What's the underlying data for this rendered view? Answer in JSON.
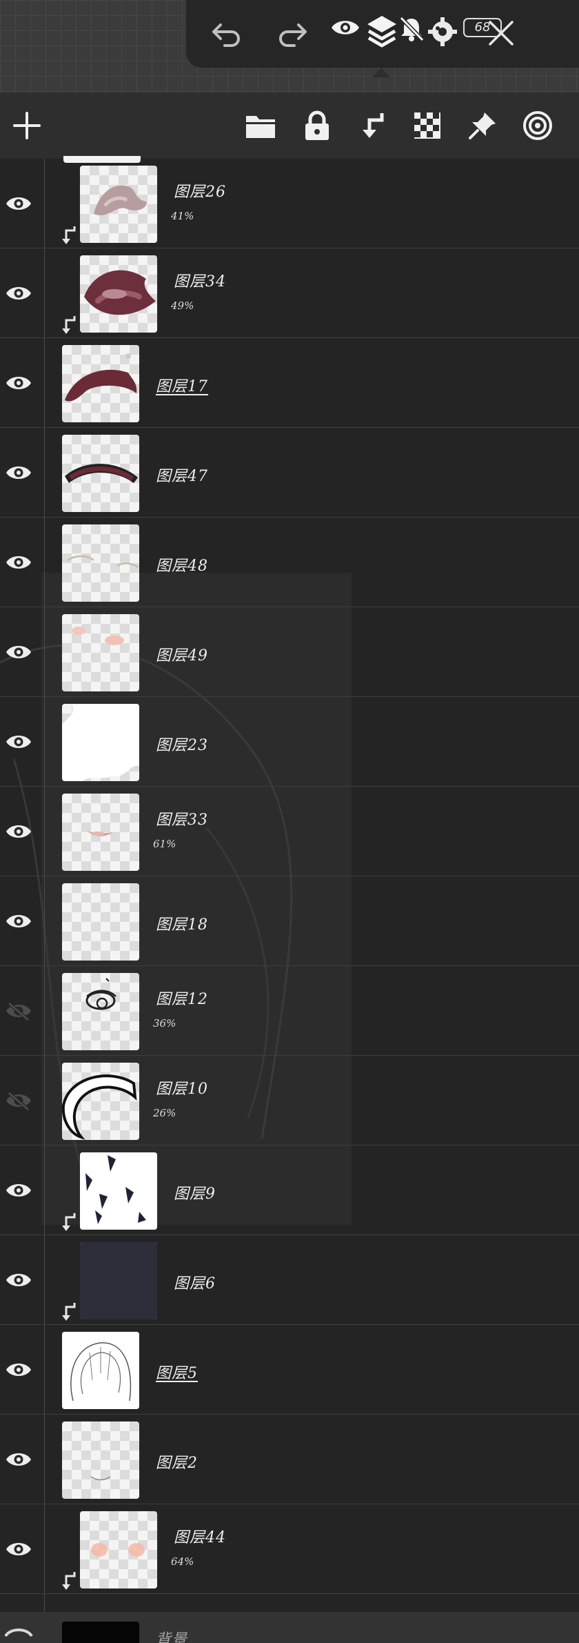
{
  "toolbar": {
    "undo_icon": "undo-icon",
    "redo_icon": "redo-icon",
    "view_icon": "eye-icon",
    "layers_icon": "layers-icon",
    "notify_icon": "bell-off-icon",
    "settings_icon": "gear-icon",
    "badge": "68",
    "close_icon": "close-icon"
  },
  "panel_header": {
    "add_icon": "plus-icon",
    "folder_icon": "folder-icon",
    "lock_icon": "lock-icon",
    "clip_icon": "clip-arrow-icon",
    "alpha_icon": "checker-icon",
    "pin_icon": "pin-icon",
    "target_icon": "target-icon"
  },
  "layers": [
    {
      "name": "图层26",
      "opacity": "41%",
      "visible": true,
      "clipped": true,
      "thumb": "pink-smudge"
    },
    {
      "name": "图层34",
      "opacity": "49%",
      "visible": true,
      "clipped": true,
      "thumb": "lips-dark"
    },
    {
      "name": "图层17",
      "opacity": "",
      "visible": true,
      "clipped": false,
      "thumb": "brow-stroke",
      "underline": true
    },
    {
      "name": "图层47",
      "opacity": "",
      "visible": true,
      "clipped": false,
      "thumb": "brow-arc"
    },
    {
      "name": "图层48",
      "opacity": "",
      "visible": true,
      "clipped": false,
      "thumb": "faint-lines"
    },
    {
      "name": "图层49",
      "opacity": "",
      "visible": true,
      "clipped": false,
      "thumb": "blush-dots"
    },
    {
      "name": "图层23",
      "opacity": "",
      "visible": true,
      "clipped": false,
      "thumb": "white-shape"
    },
    {
      "name": "图层33",
      "opacity": "61%",
      "visible": true,
      "clipped": false,
      "thumb": "small-mouth"
    },
    {
      "name": "图层18",
      "opacity": "",
      "visible": true,
      "clipped": false,
      "thumb": "empty"
    },
    {
      "name": "图层12",
      "opacity": "36%",
      "visible": false,
      "clipped": false,
      "thumb": "eye-sketch"
    },
    {
      "name": "图层10",
      "opacity": "26%",
      "visible": false,
      "clipped": false,
      "thumb": "crescent"
    },
    {
      "name": "图层9",
      "opacity": "",
      "visible": true,
      "clipped": true,
      "thumb": "dark-shards"
    },
    {
      "name": "图层6",
      "opacity": "",
      "visible": true,
      "clipped": true,
      "thumb": "dark-fill"
    },
    {
      "name": "图层5",
      "opacity": "",
      "visible": true,
      "clipped": false,
      "thumb": "hair-sketch",
      "underline": true
    },
    {
      "name": "图层2",
      "opacity": "",
      "visible": true,
      "clipped": false,
      "thumb": "tiny-curve"
    },
    {
      "name": "图层44",
      "opacity": "64%",
      "visible": true,
      "clipped": true,
      "thumb": "cheek-blush"
    }
  ],
  "background_layer": {
    "name": "背景",
    "thumb": "black"
  }
}
